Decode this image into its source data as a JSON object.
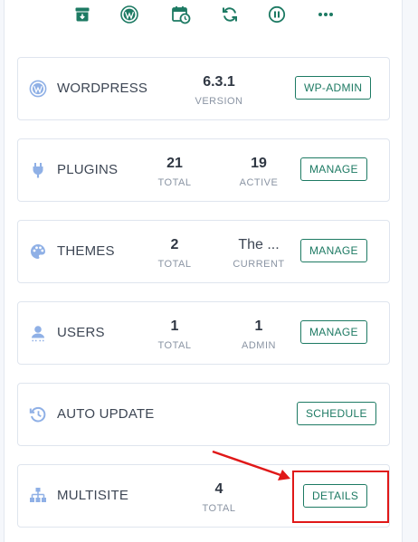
{
  "toolbar": {
    "icons": [
      "archive-icon",
      "wordpress-icon",
      "calendar-clock-icon",
      "sync-icon",
      "pause-circle-icon",
      "more-icon"
    ]
  },
  "cards": {
    "wordpress": {
      "title": "WORDPRESS",
      "stat1": {
        "value": "6.3.1",
        "label": "VERSION"
      },
      "button": "WP-ADMIN"
    },
    "plugins": {
      "title": "PLUGINS",
      "stat1": {
        "value": "21",
        "label": "TOTAL"
      },
      "stat2": {
        "value": "19",
        "label": "ACTIVE"
      },
      "button": "MANAGE"
    },
    "themes": {
      "title": "THEMES",
      "stat1": {
        "value": "2",
        "label": "TOTAL"
      },
      "stat2": {
        "value": "The ...",
        "label": "CURRENT"
      },
      "button": "MANAGE"
    },
    "users": {
      "title": "USERS",
      "stat1": {
        "value": "1",
        "label": "TOTAL"
      },
      "stat2": {
        "value": "1",
        "label": "ADMIN"
      },
      "button": "MANAGE"
    },
    "auto_update": {
      "title": "AUTO UPDATE",
      "button": "SCHEDULE"
    },
    "multisite": {
      "title": "MULTISITE",
      "stat1": {
        "value": "4",
        "label": "TOTAL"
      },
      "button": "DETAILS"
    }
  },
  "colors": {
    "accent": "#1d7a63",
    "icon": "#8fb0e6",
    "annotation": "#e01818"
  }
}
